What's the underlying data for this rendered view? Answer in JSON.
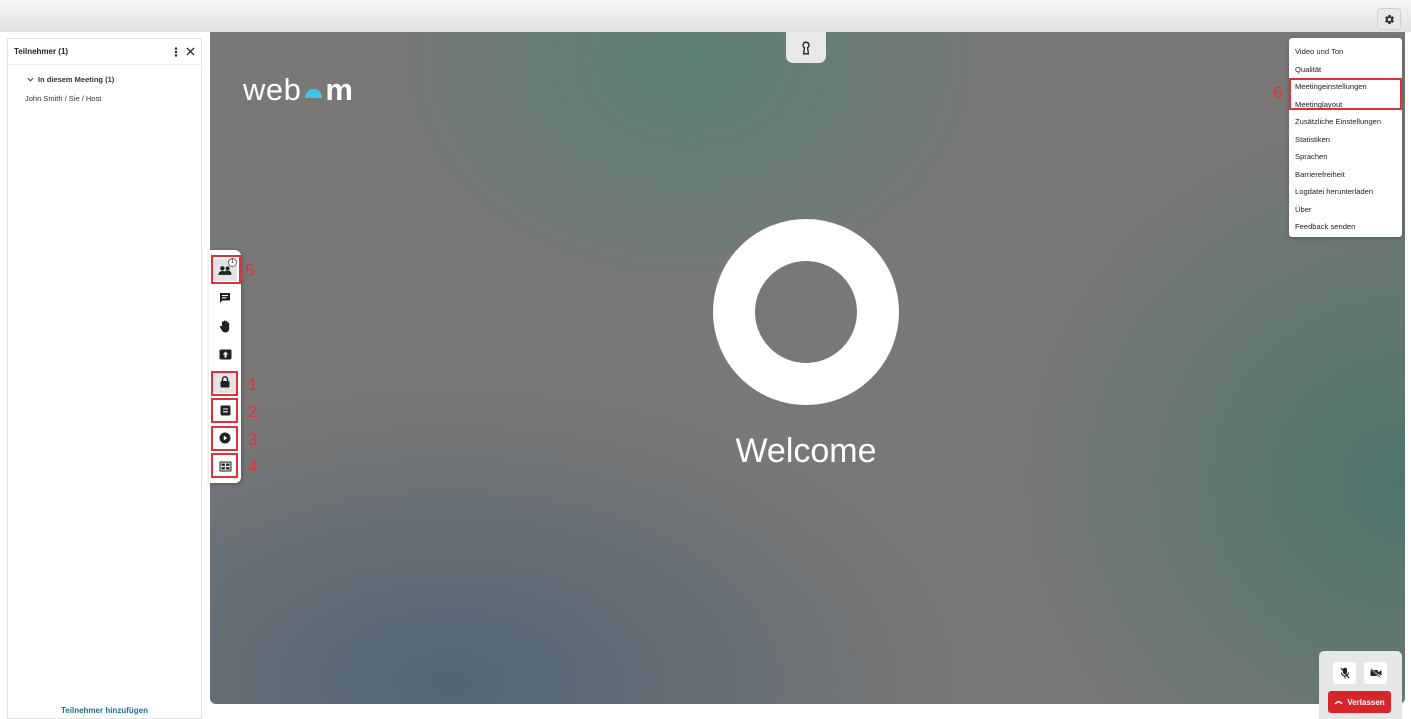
{
  "sidebar": {
    "title": "Teilnehmer (1)",
    "section_label": "In diesem Meeting (1)",
    "participants": [
      "John Smith / Sie / Host"
    ],
    "add_label": "Teilnehmer hinzufügen"
  },
  "stage": {
    "logo_left": "web",
    "logo_right": "m",
    "welcome_text": "Welcome"
  },
  "toolbar": {
    "participants_badge": "1",
    "buttons": [
      "participants-icon",
      "chat-icon",
      "raise-hand-icon",
      "share-screen-icon",
      "lock-icon",
      "info-icon",
      "play-icon",
      "layout-icon"
    ]
  },
  "annotations": {
    "n1": "1",
    "n2": "2",
    "n3": "3",
    "n4": "4",
    "n5": "5",
    "n6": "6",
    "color": "#e0313a"
  },
  "settings_menu": {
    "items": [
      "Video und Ton",
      "Qualität",
      "Meetingeinstellungen",
      "Meetinglayout",
      "Zusätzliche Einstellungen",
      "Statistiken",
      "Sprachen",
      "Barrierefreiheit",
      "Logdatei herunterladen",
      "Über",
      "Feedback senden"
    ]
  },
  "controls": {
    "leave_label": "Verlassen",
    "leave_color": "#d6262c"
  }
}
